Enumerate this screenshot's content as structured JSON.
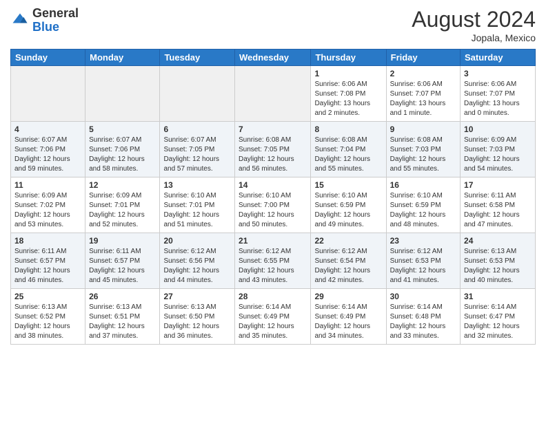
{
  "header": {
    "logo_general": "General",
    "logo_blue": "Blue",
    "month_year": "August 2024",
    "location": "Jopala, Mexico"
  },
  "weekdays": [
    "Sunday",
    "Monday",
    "Tuesday",
    "Wednesday",
    "Thursday",
    "Friday",
    "Saturday"
  ],
  "weeks": [
    [
      {
        "day": "",
        "sunrise": "",
        "sunset": "",
        "daylight": "",
        "empty": true
      },
      {
        "day": "",
        "sunrise": "",
        "sunset": "",
        "daylight": "",
        "empty": true
      },
      {
        "day": "",
        "sunrise": "",
        "sunset": "",
        "daylight": "",
        "empty": true
      },
      {
        "day": "",
        "sunrise": "",
        "sunset": "",
        "daylight": "",
        "empty": true
      },
      {
        "day": "1",
        "sunrise": "Sunrise: 6:06 AM",
        "sunset": "Sunset: 7:08 PM",
        "daylight": "Daylight: 13 hours and 2 minutes.",
        "empty": false
      },
      {
        "day": "2",
        "sunrise": "Sunrise: 6:06 AM",
        "sunset": "Sunset: 7:07 PM",
        "daylight": "Daylight: 13 hours and 1 minute.",
        "empty": false
      },
      {
        "day": "3",
        "sunrise": "Sunrise: 6:06 AM",
        "sunset": "Sunset: 7:07 PM",
        "daylight": "Daylight: 13 hours and 0 minutes.",
        "empty": false
      }
    ],
    [
      {
        "day": "4",
        "sunrise": "Sunrise: 6:07 AM",
        "sunset": "Sunset: 7:06 PM",
        "daylight": "Daylight: 12 hours and 59 minutes.",
        "empty": false
      },
      {
        "day": "5",
        "sunrise": "Sunrise: 6:07 AM",
        "sunset": "Sunset: 7:06 PM",
        "daylight": "Daylight: 12 hours and 58 minutes.",
        "empty": false
      },
      {
        "day": "6",
        "sunrise": "Sunrise: 6:07 AM",
        "sunset": "Sunset: 7:05 PM",
        "daylight": "Daylight: 12 hours and 57 minutes.",
        "empty": false
      },
      {
        "day": "7",
        "sunrise": "Sunrise: 6:08 AM",
        "sunset": "Sunset: 7:05 PM",
        "daylight": "Daylight: 12 hours and 56 minutes.",
        "empty": false
      },
      {
        "day": "8",
        "sunrise": "Sunrise: 6:08 AM",
        "sunset": "Sunset: 7:04 PM",
        "daylight": "Daylight: 12 hours and 55 minutes.",
        "empty": false
      },
      {
        "day": "9",
        "sunrise": "Sunrise: 6:08 AM",
        "sunset": "Sunset: 7:03 PM",
        "daylight": "Daylight: 12 hours and 55 minutes.",
        "empty": false
      },
      {
        "day": "10",
        "sunrise": "Sunrise: 6:09 AM",
        "sunset": "Sunset: 7:03 PM",
        "daylight": "Daylight: 12 hours and 54 minutes.",
        "empty": false
      }
    ],
    [
      {
        "day": "11",
        "sunrise": "Sunrise: 6:09 AM",
        "sunset": "Sunset: 7:02 PM",
        "daylight": "Daylight: 12 hours and 53 minutes.",
        "empty": false
      },
      {
        "day": "12",
        "sunrise": "Sunrise: 6:09 AM",
        "sunset": "Sunset: 7:01 PM",
        "daylight": "Daylight: 12 hours and 52 minutes.",
        "empty": false
      },
      {
        "day": "13",
        "sunrise": "Sunrise: 6:10 AM",
        "sunset": "Sunset: 7:01 PM",
        "daylight": "Daylight: 12 hours and 51 minutes.",
        "empty": false
      },
      {
        "day": "14",
        "sunrise": "Sunrise: 6:10 AM",
        "sunset": "Sunset: 7:00 PM",
        "daylight": "Daylight: 12 hours and 50 minutes.",
        "empty": false
      },
      {
        "day": "15",
        "sunrise": "Sunrise: 6:10 AM",
        "sunset": "Sunset: 6:59 PM",
        "daylight": "Daylight: 12 hours and 49 minutes.",
        "empty": false
      },
      {
        "day": "16",
        "sunrise": "Sunrise: 6:10 AM",
        "sunset": "Sunset: 6:59 PM",
        "daylight": "Daylight: 12 hours and 48 minutes.",
        "empty": false
      },
      {
        "day": "17",
        "sunrise": "Sunrise: 6:11 AM",
        "sunset": "Sunset: 6:58 PM",
        "daylight": "Daylight: 12 hours and 47 minutes.",
        "empty": false
      }
    ],
    [
      {
        "day": "18",
        "sunrise": "Sunrise: 6:11 AM",
        "sunset": "Sunset: 6:57 PM",
        "daylight": "Daylight: 12 hours and 46 minutes.",
        "empty": false
      },
      {
        "day": "19",
        "sunrise": "Sunrise: 6:11 AM",
        "sunset": "Sunset: 6:57 PM",
        "daylight": "Daylight: 12 hours and 45 minutes.",
        "empty": false
      },
      {
        "day": "20",
        "sunrise": "Sunrise: 6:12 AM",
        "sunset": "Sunset: 6:56 PM",
        "daylight": "Daylight: 12 hours and 44 minutes.",
        "empty": false
      },
      {
        "day": "21",
        "sunrise": "Sunrise: 6:12 AM",
        "sunset": "Sunset: 6:55 PM",
        "daylight": "Daylight: 12 hours and 43 minutes.",
        "empty": false
      },
      {
        "day": "22",
        "sunrise": "Sunrise: 6:12 AM",
        "sunset": "Sunset: 6:54 PM",
        "daylight": "Daylight: 12 hours and 42 minutes.",
        "empty": false
      },
      {
        "day": "23",
        "sunrise": "Sunrise: 6:12 AM",
        "sunset": "Sunset: 6:53 PM",
        "daylight": "Daylight: 12 hours and 41 minutes.",
        "empty": false
      },
      {
        "day": "24",
        "sunrise": "Sunrise: 6:13 AM",
        "sunset": "Sunset: 6:53 PM",
        "daylight": "Daylight: 12 hours and 40 minutes.",
        "empty": false
      }
    ],
    [
      {
        "day": "25",
        "sunrise": "Sunrise: 6:13 AM",
        "sunset": "Sunset: 6:52 PM",
        "daylight": "Daylight: 12 hours and 38 minutes.",
        "empty": false
      },
      {
        "day": "26",
        "sunrise": "Sunrise: 6:13 AM",
        "sunset": "Sunset: 6:51 PM",
        "daylight": "Daylight: 12 hours and 37 minutes.",
        "empty": false
      },
      {
        "day": "27",
        "sunrise": "Sunrise: 6:13 AM",
        "sunset": "Sunset: 6:50 PM",
        "daylight": "Daylight: 12 hours and 36 minutes.",
        "empty": false
      },
      {
        "day": "28",
        "sunrise": "Sunrise: 6:14 AM",
        "sunset": "Sunset: 6:49 PM",
        "daylight": "Daylight: 12 hours and 35 minutes.",
        "empty": false
      },
      {
        "day": "29",
        "sunrise": "Sunrise: 6:14 AM",
        "sunset": "Sunset: 6:49 PM",
        "daylight": "Daylight: 12 hours and 34 minutes.",
        "empty": false
      },
      {
        "day": "30",
        "sunrise": "Sunrise: 6:14 AM",
        "sunset": "Sunset: 6:48 PM",
        "daylight": "Daylight: 12 hours and 33 minutes.",
        "empty": false
      },
      {
        "day": "31",
        "sunrise": "Sunrise: 6:14 AM",
        "sunset": "Sunset: 6:47 PM",
        "daylight": "Daylight: 12 hours and 32 minutes.",
        "empty": false
      }
    ]
  ]
}
